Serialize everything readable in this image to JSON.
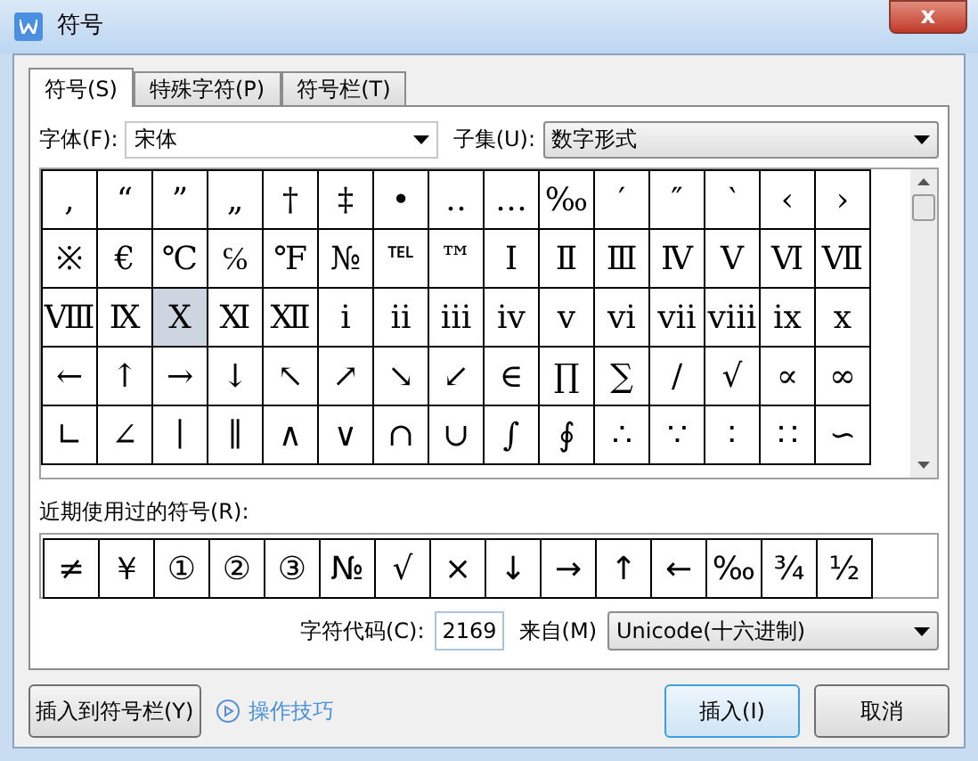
{
  "window": {
    "title": "符号",
    "close": "x"
  },
  "tabs": [
    {
      "label": "符号(S)",
      "selected": true
    },
    {
      "label": "特殊字符(P)",
      "selected": false
    },
    {
      "label": "符号栏(T)",
      "selected": false
    }
  ],
  "font": {
    "label": "字体(F):",
    "value": "宋体"
  },
  "subset": {
    "label": "子集(U):",
    "value": "数字形式"
  },
  "symbols": [
    [
      {
        "char": ",",
        "selected": false
      },
      {
        "char": "“",
        "selected": false
      },
      {
        "char": "”",
        "selected": false
      },
      {
        "char": "„",
        "selected": false
      },
      {
        "char": "†",
        "selected": false
      },
      {
        "char": "‡",
        "selected": false
      },
      {
        "char": "•",
        "selected": false
      },
      {
        "char": "‥",
        "selected": false
      },
      {
        "char": "…",
        "selected": false
      },
      {
        "char": "‰",
        "selected": false
      },
      {
        "char": "′",
        "selected": false
      },
      {
        "char": "″",
        "selected": false
      },
      {
        "char": "‵",
        "selected": false
      },
      {
        "char": "‹",
        "selected": false
      },
      {
        "char": "›",
        "selected": false
      }
    ],
    [
      {
        "char": "※",
        "selected": false
      },
      {
        "char": "€",
        "selected": false
      },
      {
        "char": "℃",
        "selected": false
      },
      {
        "char": "℅",
        "selected": false
      },
      {
        "char": "℉",
        "selected": false
      },
      {
        "char": "№",
        "selected": false
      },
      {
        "char": "℡",
        "selected": false
      },
      {
        "char": "™",
        "selected": false
      },
      {
        "char": "Ⅰ",
        "selected": false
      },
      {
        "char": "Ⅱ",
        "selected": false
      },
      {
        "char": "Ⅲ",
        "selected": false
      },
      {
        "char": "Ⅳ",
        "selected": false
      },
      {
        "char": "Ⅴ",
        "selected": false
      },
      {
        "char": "Ⅵ",
        "selected": false
      },
      {
        "char": "Ⅶ",
        "selected": false
      }
    ],
    [
      {
        "char": "Ⅷ",
        "selected": false
      },
      {
        "char": "Ⅸ",
        "selected": false
      },
      {
        "char": "Ⅹ",
        "selected": true
      },
      {
        "char": "Ⅺ",
        "selected": false
      },
      {
        "char": "Ⅻ",
        "selected": false
      },
      {
        "char": "ⅰ",
        "selected": false
      },
      {
        "char": "ⅱ",
        "selected": false
      },
      {
        "char": "ⅲ",
        "selected": false
      },
      {
        "char": "ⅳ",
        "selected": false
      },
      {
        "char": "ⅴ",
        "selected": false
      },
      {
        "char": "ⅵ",
        "selected": false
      },
      {
        "char": "ⅶ",
        "selected": false
      },
      {
        "char": "ⅷ",
        "selected": false
      },
      {
        "char": "ⅸ",
        "selected": false
      },
      {
        "char": "ⅹ",
        "selected": false
      }
    ],
    [
      {
        "char": "←",
        "selected": false
      },
      {
        "char": "↑",
        "selected": false
      },
      {
        "char": "→",
        "selected": false
      },
      {
        "char": "↓",
        "selected": false
      },
      {
        "char": "↖",
        "selected": false
      },
      {
        "char": "↗",
        "selected": false
      },
      {
        "char": "↘",
        "selected": false
      },
      {
        "char": "↙",
        "selected": false
      },
      {
        "char": "∈",
        "selected": false
      },
      {
        "char": "∏",
        "selected": false
      },
      {
        "char": "∑",
        "selected": false
      },
      {
        "char": "∕",
        "selected": false
      },
      {
        "char": "√",
        "selected": false
      },
      {
        "char": "∝",
        "selected": false
      },
      {
        "char": "∞",
        "selected": false
      }
    ],
    [
      {
        "char": "∟",
        "selected": false
      },
      {
        "char": "∠",
        "selected": false
      },
      {
        "char": "∣",
        "selected": false
      },
      {
        "char": "∥",
        "selected": false
      },
      {
        "char": "∧",
        "selected": false
      },
      {
        "char": "∨",
        "selected": false
      },
      {
        "char": "∩",
        "selected": false
      },
      {
        "char": "∪",
        "selected": false
      },
      {
        "char": "∫",
        "selected": false
      },
      {
        "char": "∮",
        "selected": false
      },
      {
        "char": "∴",
        "selected": false
      },
      {
        "char": "∵",
        "selected": false
      },
      {
        "char": "∶",
        "selected": false
      },
      {
        "char": "∷",
        "selected": false
      },
      {
        "char": "∽",
        "selected": false
      }
    ]
  ],
  "recent_label": "近期使用过的符号(R):",
  "recent": [
    "≠",
    "￥",
    "①",
    "②",
    "③",
    "№",
    "√",
    "×",
    "↓",
    "→",
    "↑",
    "←",
    "‰",
    "¾",
    "½"
  ],
  "char_code": {
    "label": "字符代码(C):",
    "value": "2169"
  },
  "from": {
    "label": "来自(M)",
    "value": "Unicode(十六进制)"
  },
  "buttons": {
    "insert_to_bar": "插入到符号栏(Y)",
    "tips": "操作技巧",
    "insert": "插入(I)",
    "cancel": "取消"
  }
}
